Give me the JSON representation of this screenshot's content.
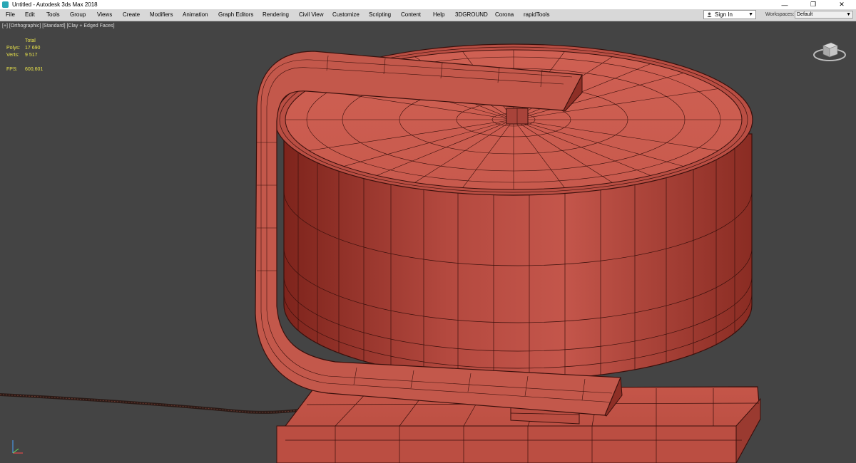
{
  "window": {
    "title": "Untitled - Autodesk 3ds Max 2018",
    "minimize_glyph": "—",
    "restore_glyph": "❐",
    "close_glyph": "✕"
  },
  "menu": {
    "items": [
      "File",
      "Edit",
      "Tools",
      "Group",
      "Views",
      "Create",
      "Modifiers",
      "Animation",
      "Graph Editors",
      "Rendering",
      "Civil View",
      "Customize",
      "Scripting",
      "Content",
      "Help",
      "3DGROUND",
      "Corona",
      "rapidTools"
    ],
    "sign_in": "Sign In",
    "workspaces_label": "Workspaces:",
    "workspace_value": "Default"
  },
  "viewport": {
    "label": "[+] [Orthographic] [Standard] [Clay + Edged Faces]",
    "stats": {
      "header": "Total",
      "polys_label": "Polys:",
      "polys_value": "17 690",
      "verts_label": "Verts:",
      "verts_value": "9 517",
      "fps_label": "FPS:",
      "fps_value": "600,601"
    },
    "clay_color": "#c8574b",
    "clay_shadow": "#8e2f26",
    "wire_color": "#3a100c",
    "background": "#444444"
  },
  "icons": {
    "app": "3dsmax-app-icon",
    "user": "user-icon",
    "viewcube": "viewcube-icon",
    "axis": "axis-tripod-icon"
  }
}
